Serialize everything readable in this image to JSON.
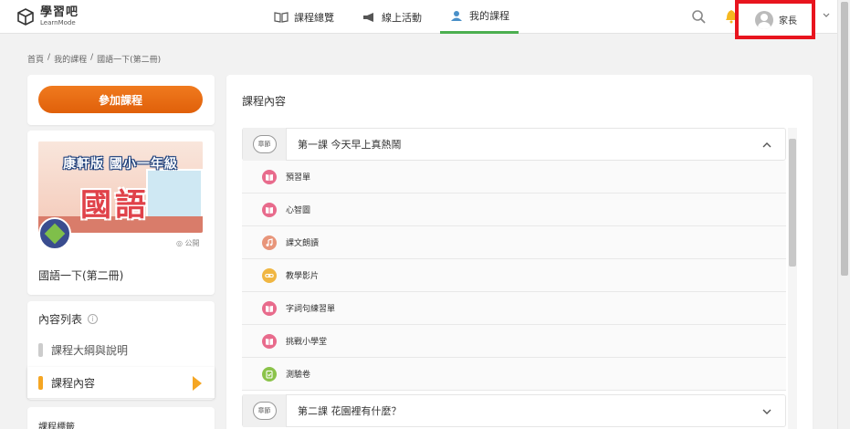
{
  "header": {
    "logo_main": "學習吧",
    "logo_sub": "LearnMode",
    "nav": [
      {
        "label": "課程總覽"
      },
      {
        "label": "線上活動"
      },
      {
        "label": "我的課程"
      }
    ],
    "user_name": "家長"
  },
  "breadcrumb": [
    "首頁",
    "/",
    "我的課程",
    "/",
    "國語一下(第二冊)"
  ],
  "sidebar": {
    "join_label": "參加課程",
    "cover_title": "康軒版 國小一年級",
    "cover_big": "國語",
    "public_label": "公開",
    "course_name": "國語一下(第二冊)",
    "toc_title": "內容列表",
    "toc_items": [
      {
        "label": "課程大綱與說明"
      },
      {
        "label": "課程內容"
      }
    ],
    "tags_title": "課程標籤"
  },
  "content": {
    "title": "課程內容",
    "chapter_tag": "章節",
    "chapters": [
      {
        "title": "第一課 今天早上真熱鬧"
      },
      {
        "title": "第二課 花園裡有什麼？"
      }
    ],
    "lessons": [
      {
        "label": "預習單",
        "icon": "book-icon",
        "color": "#e86b8c"
      },
      {
        "label": "心智圖",
        "icon": "book-icon",
        "color": "#e86b8c"
      },
      {
        "label": "課文朗讀",
        "icon": "music-icon",
        "color": "#e8957a"
      },
      {
        "label": "教學影片",
        "icon": "link-icon",
        "color": "#f0b642"
      },
      {
        "label": "字詞句練習單",
        "icon": "book-icon",
        "color": "#e86b8c"
      },
      {
        "label": "挑戰小學堂",
        "icon": "book-icon",
        "color": "#e86b8c"
      },
      {
        "label": "測驗卷",
        "icon": "quiz-icon",
        "color": "#8bc34a"
      }
    ]
  },
  "colors": {
    "accent_orange": "#e86c14",
    "nav_active": "#4caf50",
    "highlight_red": "#e8141e"
  }
}
